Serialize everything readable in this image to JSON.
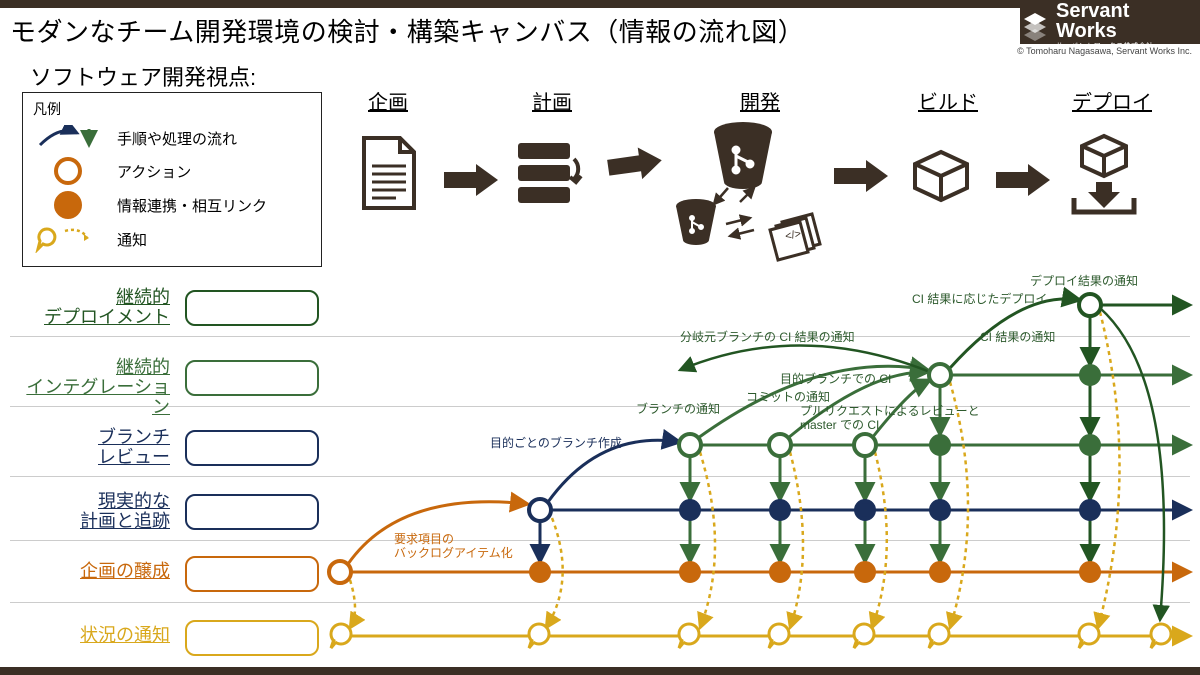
{
  "header": {
    "title": "モダンなチーム開発環境の検討・構築キャンバス（情報の流れ図）",
    "subtitle": "ソフトウェア開発視点:",
    "logo_text": "Servant Works",
    "logo_sub": "サーバントワークス株式会社",
    "copyright": "© Tomoharu Nagasawa, Servant Works Inc."
  },
  "legend": {
    "title": "凡例",
    "items": {
      "flow": "手順や処理の流れ",
      "action": "アクション",
      "link": "情報連携・相互リンク",
      "notify": "通知"
    }
  },
  "phases": {
    "plan": "企画",
    "schedule": "計画",
    "dev": "開発",
    "build": "ビルド",
    "deploy": "デプロイ"
  },
  "lanes": {
    "cd": "継続的\nデプロイメント",
    "ci": "継続的\nインテグレーション",
    "branch": "ブランチ\nレビュー",
    "track": "現実的な\n計画と追跡",
    "ideate": "企画の醸成",
    "notify": "状況の通知"
  },
  "annotations": {
    "deploy_result": "デプロイ結果の通知",
    "ci_based_deploy": "CI 結果に応じたデプロイ",
    "branch_ci_notify": "分岐元ブランチの CI 結果の通知",
    "ci_result_notify": "CI 結果の通知",
    "target_branch_ci": "目的ブランチでの CI",
    "commit_notify": "コミットの通知",
    "branch_notify": "ブランチの通知",
    "pr_review": "プルリクエストによるレビューと\nmaster での CI",
    "branch_per_purpose": "目的ごとのブランチ作成",
    "backlog": "要求項目の\nバックログアイテム化"
  },
  "colors": {
    "navy": "#1a2f5a",
    "green": "#3a6e3a",
    "dgreen": "#225522",
    "orange": "#c8680c",
    "gold": "#d9a81c",
    "brown": "#3b2f25"
  }
}
